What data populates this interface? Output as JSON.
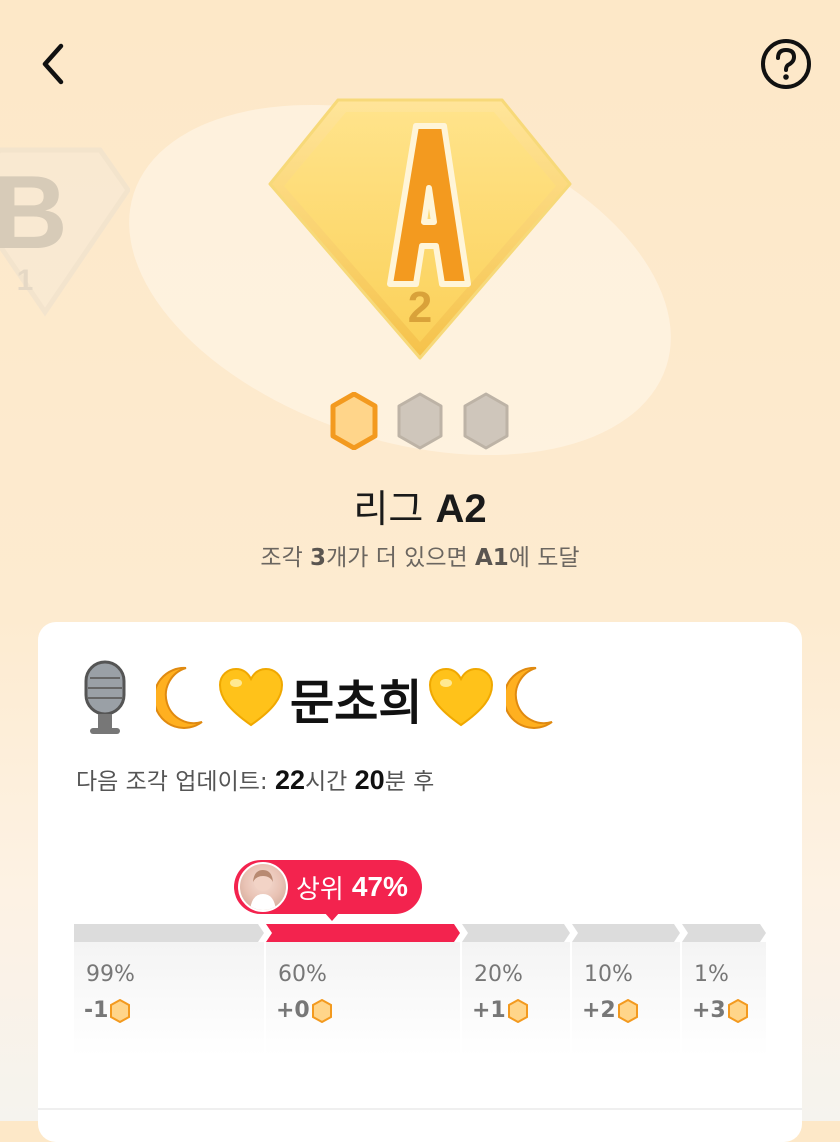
{
  "header": {
    "back_icon": "chevron-left-icon",
    "help_icon": "question-circle-icon"
  },
  "badges": {
    "current": {
      "letter": "A",
      "level": "2"
    },
    "previous": {
      "letter": "B",
      "level": "1"
    }
  },
  "pieces": {
    "filled": 1,
    "total": 3,
    "filled_color": "#f39a1f",
    "empty_color": "#cfc6bb"
  },
  "league": {
    "prefix": "리그",
    "name": "A2",
    "progress_pre": "조각",
    "progress_count": "3",
    "progress_mid": "개가 더 있으면",
    "progress_target": "A1",
    "progress_post": "에 도달"
  },
  "user": {
    "name": "문초희"
  },
  "next_update": {
    "label": "다음 조각 업데이트:",
    "hours": "22",
    "hours_unit": "시간",
    "minutes": "20",
    "minutes_unit": "분 후"
  },
  "rank": {
    "label": "상위",
    "value": "47%"
  },
  "tiers": [
    {
      "pct": "99%",
      "reward": "-1"
    },
    {
      "pct": "60%",
      "reward": "+0"
    },
    {
      "pct": "20%",
      "reward": "+1"
    },
    {
      "pct": "10%",
      "reward": "+2"
    },
    {
      "pct": "1%",
      "reward": "+3"
    }
  ],
  "colors": {
    "accent": "#f3234e",
    "gold": "#f39a1f"
  }
}
